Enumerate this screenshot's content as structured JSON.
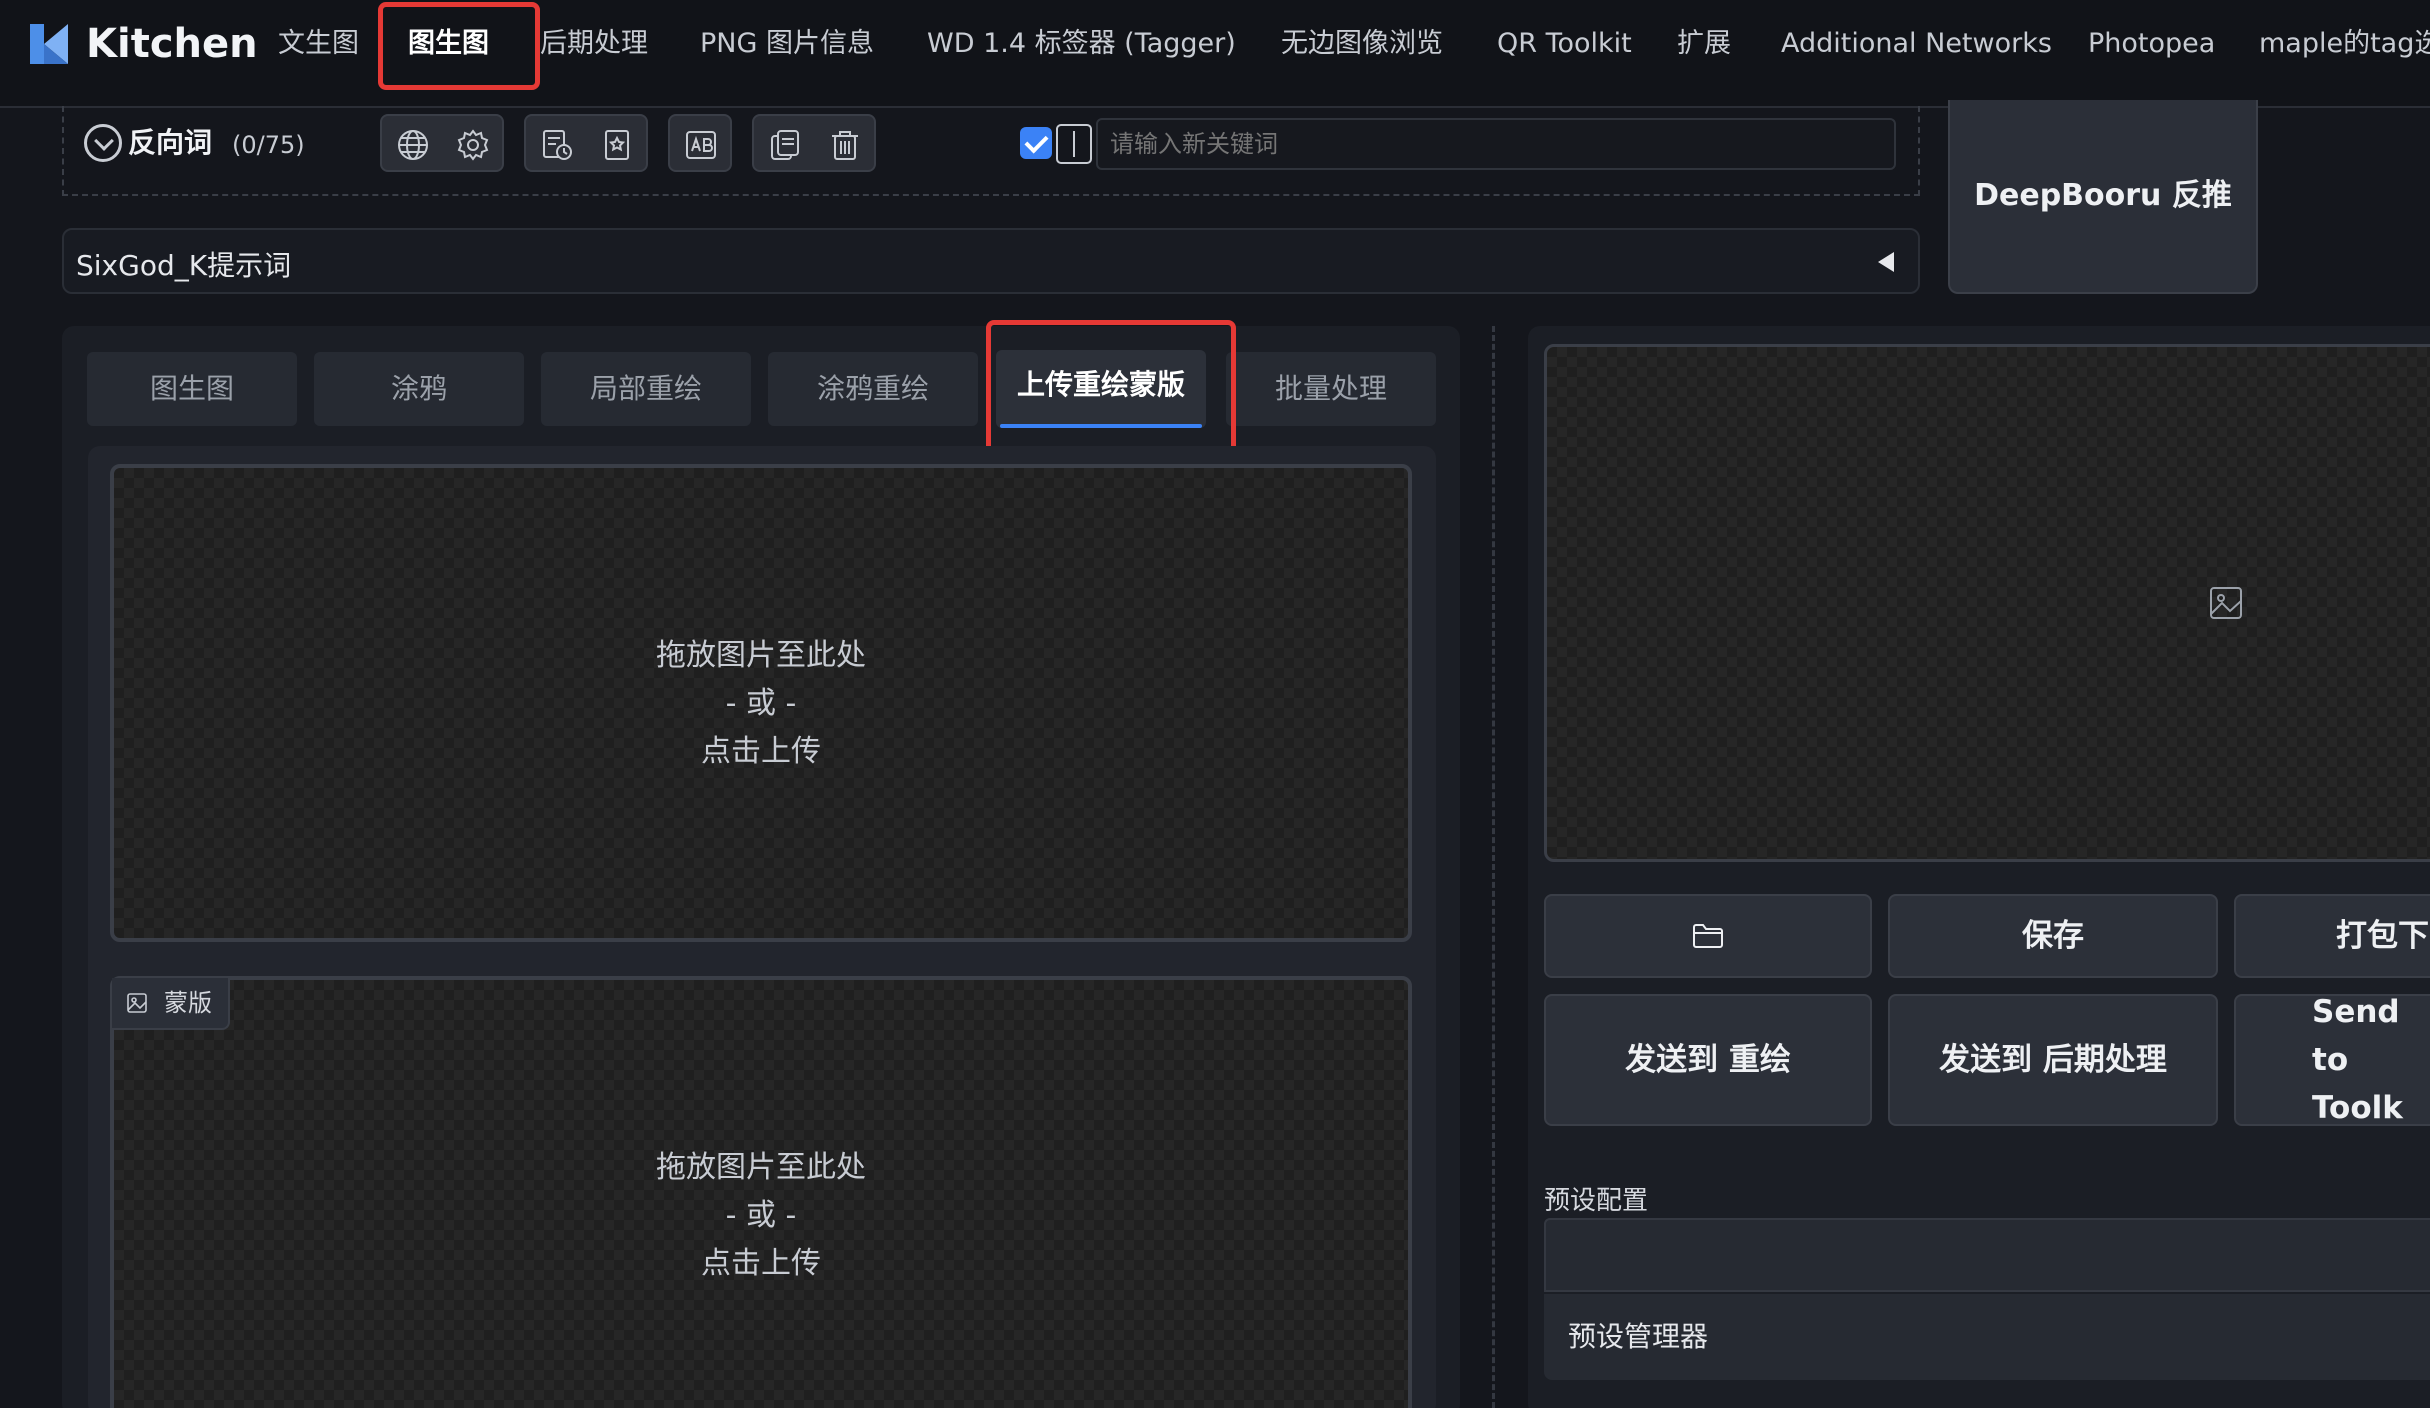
{
  "app": {
    "title": "Kitchen"
  },
  "nav": {
    "tabs": [
      {
        "label": "文生图"
      },
      {
        "label": "图生图"
      },
      {
        "label": "后期处理"
      },
      {
        "label": "PNG 图片信息"
      },
      {
        "label": "WD 1.4 标签器 (Tagger)"
      },
      {
        "label": "无边图像浏览"
      },
      {
        "label": "QR Toolkit"
      },
      {
        "label": "扩展"
      },
      {
        "label": "Additional Networks"
      },
      {
        "label": "Photopea"
      },
      {
        "label": "maple的tag选"
      }
    ],
    "active": "图生图"
  },
  "negative_prompt": {
    "label": "反向词",
    "count": "(0/75)",
    "keyword_placeholder": "请输入新关键词",
    "keyword_checked": true
  },
  "deepbooru_button": "DeepBooru 反推",
  "sixgod": {
    "label": "SixGod_K提示词"
  },
  "subtabs": [
    {
      "label": "图生图"
    },
    {
      "label": "涂鸦"
    },
    {
      "label": "局部重绘"
    },
    {
      "label": "涂鸦重绘"
    },
    {
      "label": "上传重绘蒙版"
    },
    {
      "label": "批量处理"
    }
  ],
  "active_subtab": "上传重绘蒙版",
  "upload": {
    "line1": "拖放图片至此处",
    "line2": "- 或 -",
    "line3": "点击上传"
  },
  "mask": {
    "label": "蒙版"
  },
  "output_buttons": {
    "save": "保存",
    "zip": "打包下",
    "send_inpaint": "发送到 重绘",
    "send_extras": "发送到 后期处理",
    "send_toolkit": "Send to Toolk"
  },
  "preset": {
    "label": "预设配置",
    "manager": "预设管理器"
  },
  "colors": {
    "accent": "#3b82f6",
    "highlight": "#e53935"
  }
}
